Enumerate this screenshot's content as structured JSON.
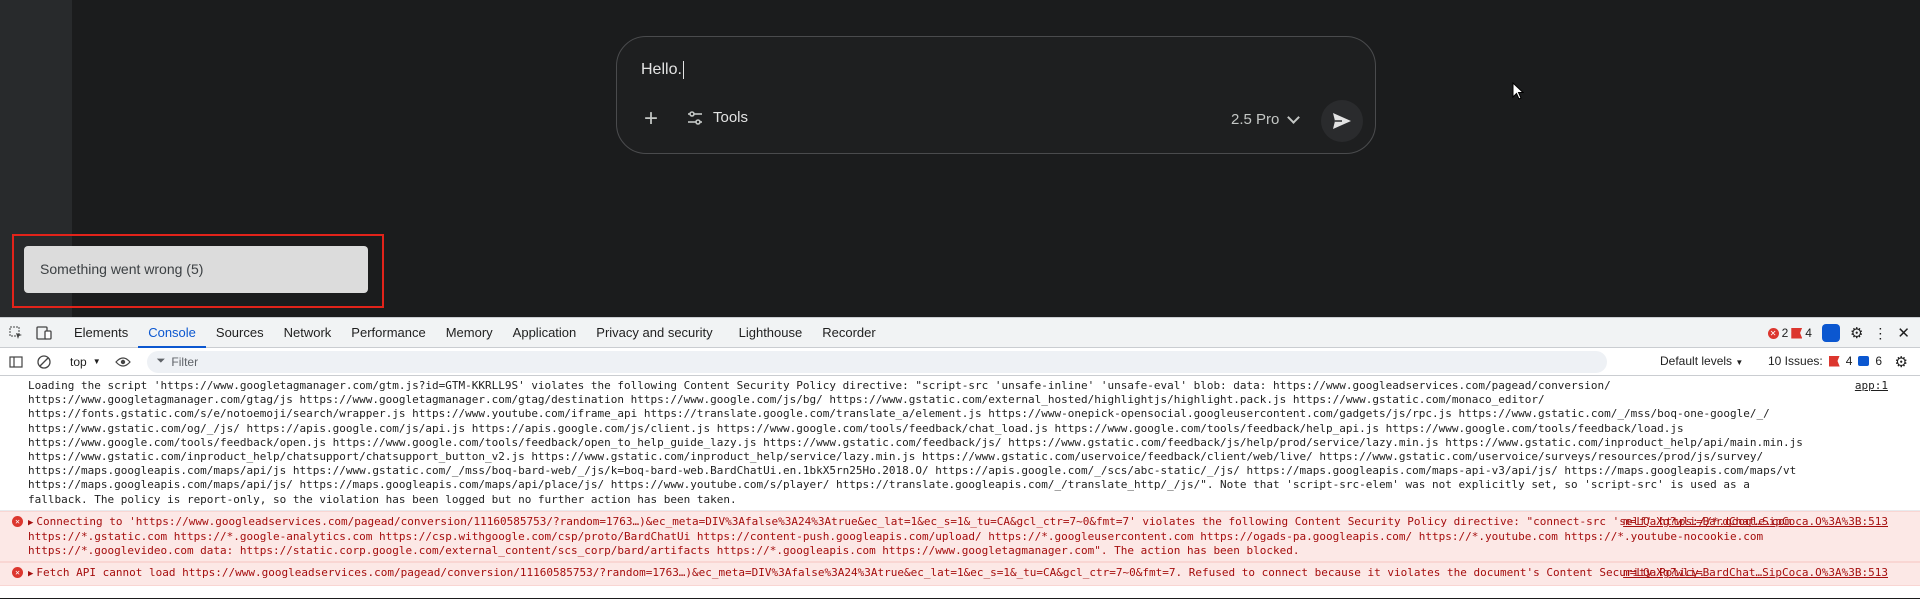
{
  "composer": {
    "text": "Hello.",
    "tools_label": "Tools",
    "model_label": "2.5 Pro"
  },
  "toast": {
    "text": "Something went wrong (5)"
  },
  "devtools": {
    "tabs": [
      "Elements",
      "Console",
      "Sources",
      "Network",
      "Performance",
      "Memory",
      "Application",
      "Privacy and security",
      "Lighthouse",
      "Recorder"
    ],
    "active_tab": "Console",
    "errors_count": "2",
    "warnings_count": "4",
    "context": "top",
    "filter_placeholder": "Filter",
    "levels": "Default levels",
    "issues_label": "10 Issues:",
    "issues_errors": "4",
    "issues_info": "6"
  },
  "console": {
    "msg1_text": "Loading the script 'https://www.googletagmanager.com/gtm.js?id=GTM-KKRLL9S' violates the following Content Security Policy directive: \"script-src 'unsafe-inline' 'unsafe-eval' blob: data: https://www.googleadservices.com/pagead/conversion/ https://www.googletagmanager.com/gtag/js https://www.googletagmanager.com/gtag/destination https://www.google.com/js/bg/ https://www.gstatic.com/external_hosted/highlightjs/highlight.pack.js https://www.gstatic.com/monaco_editor/ https://fonts.gstatic.com/s/e/notoemoji/search/wrapper.js https://www.youtube.com/iframe_api https://translate.google.com/translate_a/element.js https://www-onepick-opensocial.googleusercontent.com/gadgets/js/rpc.js https://www.gstatic.com/_/mss/boq-one-google/_/ https://www.gstatic.com/og/_/js/ https://apis.google.com/js/api.js https://apis.google.com/js/client.js https://www.google.com/tools/feedback/chat_load.js https://www.google.com/tools/feedback/help_api.js https://www.google.com/tools/feedback/load.js https://www.google.com/tools/feedback/open.js https://www.google.com/tools/feedback/open_to_help_guide_lazy.js https://www.gstatic.com/feedback/js/ https://www.gstatic.com/feedback/js/help/prod/service/lazy.min.js https://www.gstatic.com/inproduct_help/api/main.min.js https://www.gstatic.com/inproduct_help/chatsupport/chatsupport_button_v2.js https://www.gstatic.com/inproduct_help/service/lazy.min.js https://www.gstatic.com/uservoice/feedback/client/web/live/ https://www.gstatic.com/uservoice/surveys/resources/prod/js/survey/ https://maps.googleapis.com/maps/api/js https://www.gstatic.com/_/mss/boq-bard-web/_/js/k=boq-bard-web.BardChatUi.en.1bkX5rn25Ho.2018.O/ https://apis.google.com/_/scs/abc-static/_/js/ https://maps.googleapis.com/maps-api-v3/api/js/ https://maps.googleapis.com/maps/vt https://maps.googleapis.com/maps/api/js/ https://maps.googleapis.com/maps/api/place/js/ https://www.youtube.com/s/player/ https://translate.googleapis.com/_/translate_http/_/js/\". Note that 'script-src-elem' was not explicitly set, so 'script-src' is used as a fallback. The policy is report-only, so the violation has been logged but no further action has been taken.",
    "msg1_src": "app:1",
    "msg2_text": "Connecting to 'https://www.googleadservices.com/pagead/conversion/11160585753/?random=1763…)&ec_meta=DIV%3Afalse%3A24%3Atrue&ec_lat=1&ec_s=1&_tu=CA&gcl_ctr=7~0&fmt=7' violates the following Content Security Policy directive: \"connect-src 'self' https://*.google.com https://*.gstatic.com https://*.google-analytics.com https://csp.withgoogle.com/csp/proto/BardChatUi https://content-push.googleapis.com/upload/ https://*.googleusercontent.com https://ogads-pa.googleapis.com/ https://*.youtube.com https://*.youtube-nocookie.com https://*.googlevideo.com data: https://static.corp.google.com/external_content/scs_corp/bard/artifacts https://*.googleapis.com https://www.googletagmanager.com\". The action has been blocked.",
    "msg2_src": "m=LQaXg?wli=BardChat…SipCoca.O%3A%3B:513",
    "msg3_text": "Fetch API cannot load https://www.googleadservices.com/pagead/conversion/11160585753/?random=1763…)&ec_meta=DIV%3Afalse%3A24%3Atrue&ec_lat=1&ec_s=1&_tu=CA&gcl_ctr=7~0&fmt=7. Refused to connect because it violates the document's Content Security Policy.",
    "msg3_src": "m=LQaXg?wli=BardChat…SipCoca.O%3A%3B:513"
  }
}
